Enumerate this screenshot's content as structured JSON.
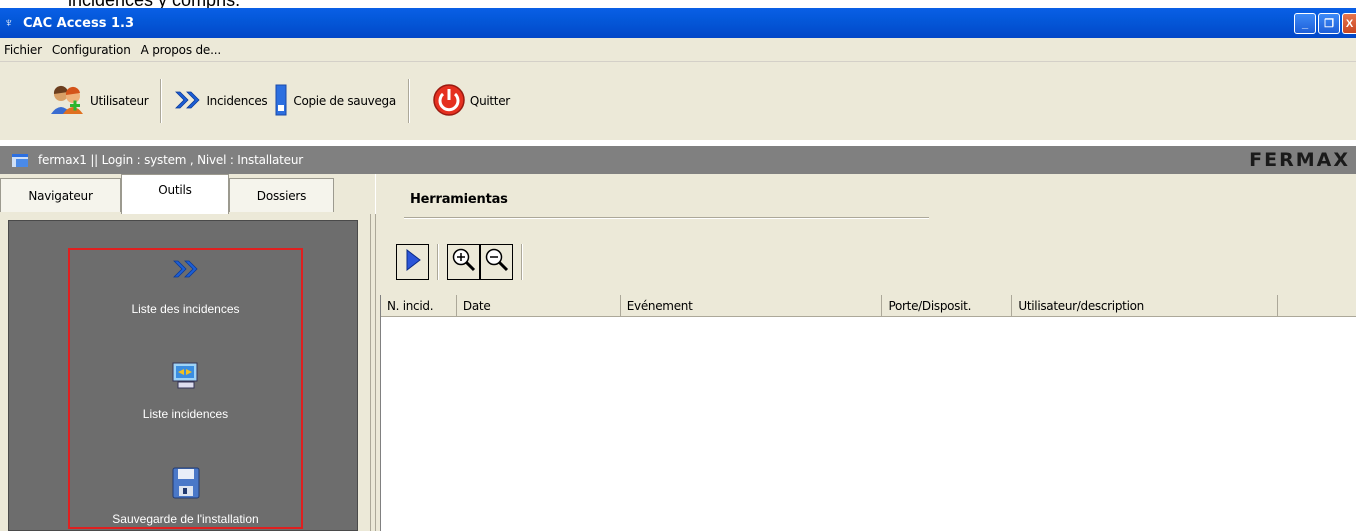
{
  "doc_fragment": "incidences y compris.",
  "window": {
    "title": "CAC Access 1.3",
    "minimize": "_",
    "restore": "❐",
    "close": "X"
  },
  "menu": [
    "Fichier",
    "Configuration",
    "A propos de..."
  ],
  "toolbar": {
    "user_label": "Utilisateur",
    "incidences_label": "Incidences",
    "backup_label": "Copie de sauvega",
    "quit_label": "Quitter"
  },
  "infobar": {
    "text": "fermax1  || Login : system , Nivel : Installateur",
    "logo": "FERMAX"
  },
  "tabs": [
    "Navigateur",
    "Outils",
    "Dossiers"
  ],
  "active_tab": "Outils",
  "tools": [
    {
      "label": "Liste des incidences",
      "icon": "double-chevron-icon"
    },
    {
      "label": "Liste incidences",
      "icon": "computer-list-icon"
    },
    {
      "label": "Sauvegarde de l'installation",
      "icon": "floppy-disk-icon"
    }
  ],
  "panel": {
    "heading": "Herramientas"
  },
  "grid": {
    "columns": [
      "N. incid.",
      "Date",
      "Evénement",
      "Porte/Disposit.",
      "Utilisateur/description"
    ],
    "rows": []
  },
  "colors": {
    "titlebar": "#0458d9",
    "chrome": "#ece9d8",
    "infobar": "#808080",
    "panel": "#6d6d6d",
    "highlight": "#e02020"
  }
}
